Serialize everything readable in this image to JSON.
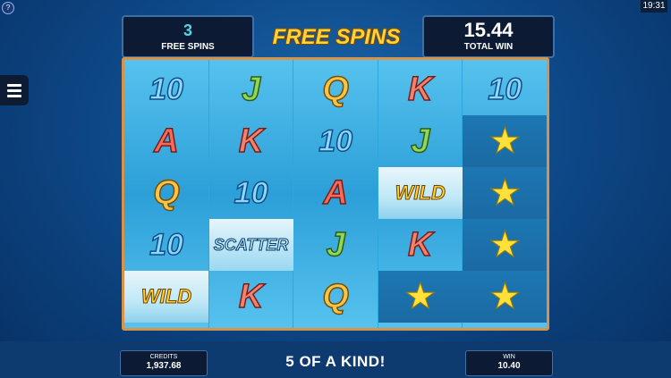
{
  "status": {
    "clock": "19:31",
    "help_icon": "?"
  },
  "header": {
    "free_spins_value": "3",
    "free_spins_label": "FREE SPINS",
    "title": "FREE SPINS",
    "total_win_value": "15.44",
    "total_win_label": "TOTAL WIN"
  },
  "reels": [
    [
      "10",
      "A",
      "Q",
      "10",
      "WILD"
    ],
    [
      "J",
      "K",
      "10",
      "SCATTER",
      "K"
    ],
    [
      "Q",
      "10",
      "A",
      "J",
      "Q"
    ],
    [
      "K",
      "J",
      "WILD",
      "K",
      "STARFISH"
    ],
    [
      "10",
      "STARFISH",
      "STARFISH",
      "STARFISH",
      "STARFISH"
    ]
  ],
  "footer": {
    "credits_label": "CREDITS",
    "credits_value": "1,937.68",
    "message": "5 OF A KIND!",
    "win_label": "WIN",
    "win_value": "10.40"
  },
  "icons": {
    "menu": "hamburger-menu-icon",
    "starfish": "starfish-icon"
  }
}
